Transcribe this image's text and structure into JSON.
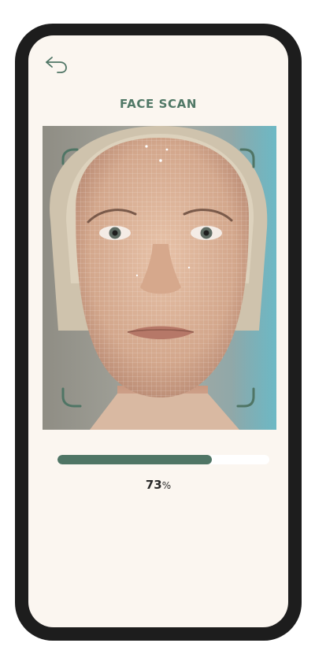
{
  "header": {
    "back_icon": "back-arrow-icon",
    "title": "FACE SCAN"
  },
  "scan": {
    "image": "face-scan-photo",
    "corner_marker_icon": "scan-corner-bracket-icon"
  },
  "progress": {
    "value": "73",
    "unit": "%",
    "fraction": 0.73
  },
  "colors": {
    "accent": "#4f7565",
    "title": "#507866",
    "background": "#fbf6f0",
    "device_frame": "#1d1d1d",
    "track": "#ffffff"
  }
}
